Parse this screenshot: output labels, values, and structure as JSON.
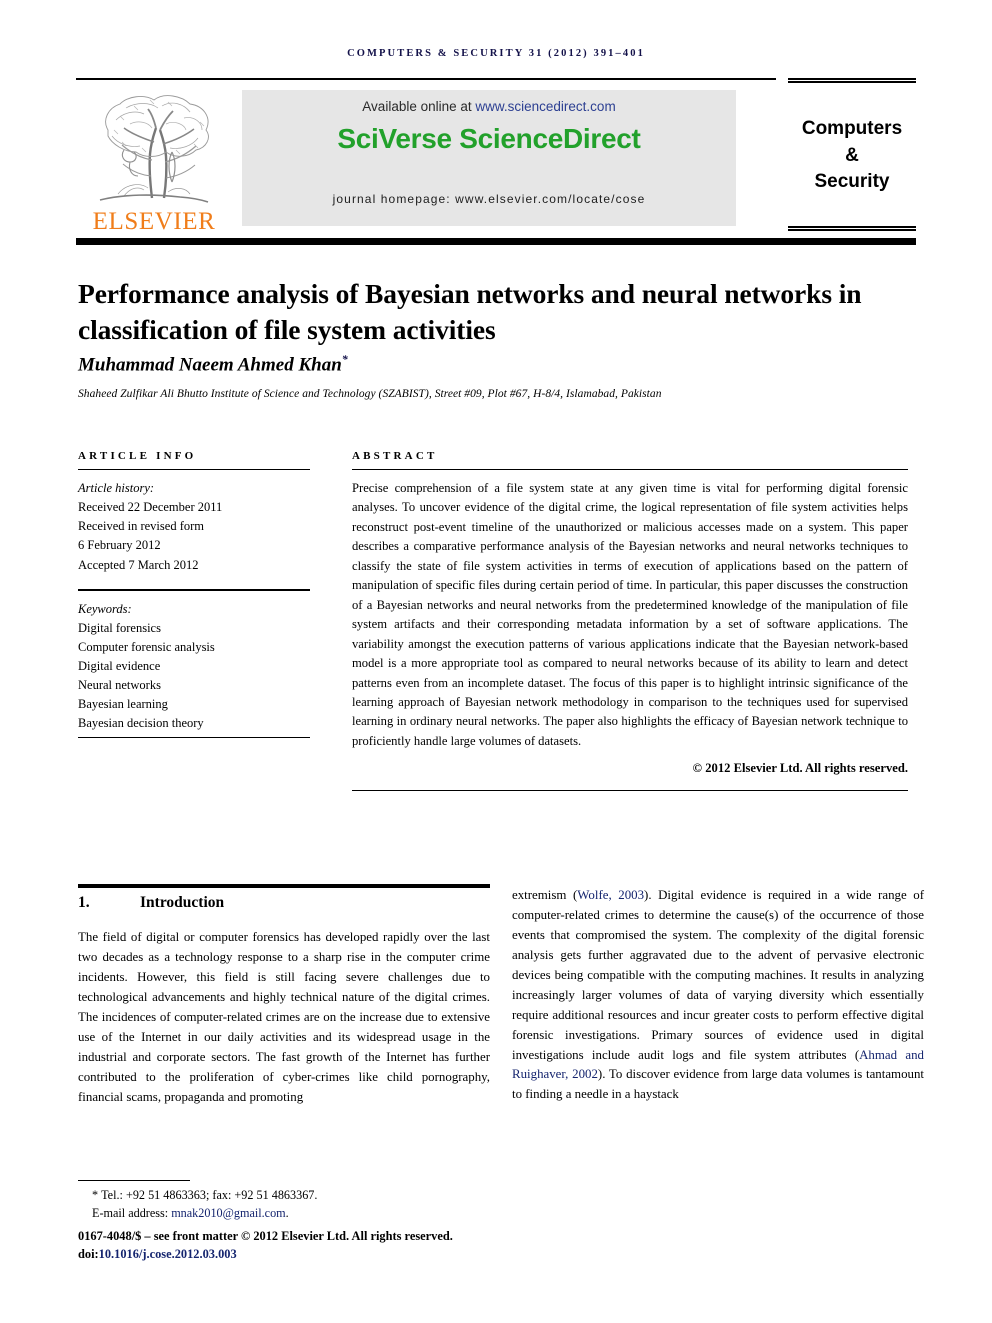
{
  "running_head": "COMPUTERS & SECURITY 31 (2012) 391–401",
  "masthead": {
    "publisher_name": "ELSEVIER",
    "available_prefix": "Available online at ",
    "available_url": "www.sciencedirect.com",
    "platform_title": "SciVerse ScienceDirect",
    "homepage": "journal homepage: www.elsevier.com/locate/cose",
    "cover": {
      "line1": "Computers",
      "line2": "&",
      "line3": "Security"
    },
    "colors": {
      "elsevier_orange": "#f07d1a",
      "sciencedirect_green": "#22a12b",
      "link_blue": "#2c3f92",
      "running_head_navy": "#14124a",
      "box_gray": "#e6e6e6"
    }
  },
  "article": {
    "title": "Performance analysis of Bayesian networks and neural networks in classification of file system activities",
    "author": "Muhammad Naeem Ahmed Khan",
    "author_marker": "*",
    "affiliation": "Shaheed Zulfikar Ali Bhutto Institute of Science and Technology (SZABIST), Street #09, Plot #67, H-8/4, Islamabad, Pakistan"
  },
  "article_info": {
    "kicker": "ARTICLE INFO",
    "history_label": "Article history:",
    "history": [
      "Received 22 December 2011",
      "Received in revised form",
      "6 February 2012",
      "Accepted 7 March 2012"
    ],
    "keywords_label": "Keywords:",
    "keywords": [
      "Digital forensics",
      "Computer forensic analysis",
      "Digital evidence",
      "Neural networks",
      "Bayesian learning",
      "Bayesian decision theory"
    ]
  },
  "abstract": {
    "kicker": "ABSTRACT",
    "text": "Precise comprehension of a file system state at any given time is vital for performing digital forensic analyses. To uncover evidence of the digital crime, the logical representation of file system activities helps reconstruct post-event timeline of the unauthorized or malicious accesses made on a system. This paper describes a comparative performance analysis of the Bayesian networks and neural networks techniques to classify the state of file system activities in terms of execution of applications based on the pattern of manipulation of specific files during certain period of time. In particular, this paper discusses the construction of a Bayesian networks and neural networks from the predetermined knowledge of the manipulation of file system artifacts and their corresponding metadata information by a set of software applications. The variability amongst the execution patterns of various applications indicate that the Bayesian network-based model is a more appropriate tool as compared to neural networks because of its ability to learn and detect patterns even from an incomplete dataset. The focus of this paper is to highlight intrinsic significance of the learning approach of Bayesian network methodology in comparison to the techniques used for supervised learning in ordinary neural networks. The paper also highlights the efficacy of Bayesian network technique to proficiently handle large volumes of datasets.",
    "copyright": "© 2012 Elsevier Ltd. All rights reserved."
  },
  "body": {
    "section_number": "1.",
    "section_title": "Introduction",
    "left_column": "The field of digital or computer forensics has developed rapidly over the last two decades as a technology response to a sharp rise in the computer crime incidents. However, this field is still facing severe challenges due to technological advancements and highly technical nature of the digital crimes. The incidences of computer-related crimes are on the increase due to extensive use of the Internet in our daily activities and its widespread usage in the industrial and corporate sectors. The fast growth of the Internet has further contributed to the proliferation of cyber-crimes like child pornography, financial scams, propaganda and promoting",
    "right_column_part1": "extremism (",
    "right_column_cite1": "Wolfe, 2003",
    "right_column_part2": "). Digital evidence is required in a wide range of computer-related crimes to determine the cause(s) of the occurrence of those events that compromised the system. The complexity of the digital forensic analysis gets further aggravated due to the advent of pervasive electronic devices being compatible with the computing machines. It results in analyzing increasingly larger volumes of data of varying diversity which essentially require additional resources and incur greater costs to perform effective digital forensic investigations. Primary sources of evidence used in digital investigations include audit logs and file system attributes (",
    "right_column_cite2": "Ahmad and Ruighaver, 2002",
    "right_column_part3": "). To discover evidence from large data volumes is tantamount to finding a needle in a haystack"
  },
  "footnote": {
    "marker": "*",
    "tel_line": "Tel.: +92 51 4863363; fax: +92 51 4863367.",
    "email_label": "E-mail address: ",
    "email": "mnak2010@gmail.com",
    "email_end": ".",
    "front_matter": "0167-4048/$ – see front matter © 2012 Elsevier Ltd. All rights reserved.",
    "doi_label": "doi:",
    "doi": "10.1016/j.cose.2012.03.003"
  }
}
